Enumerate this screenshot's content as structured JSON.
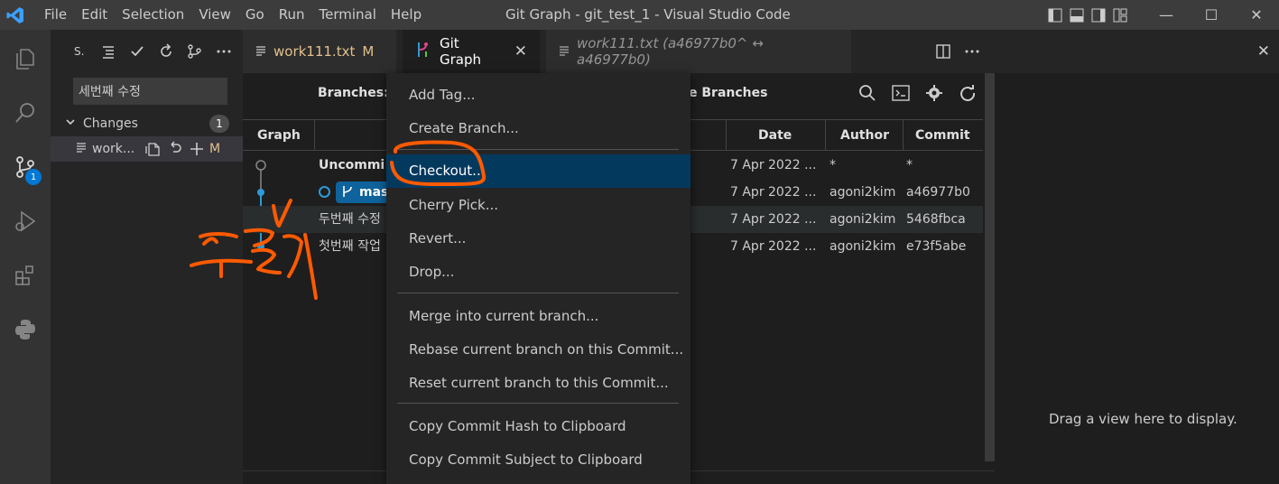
{
  "titlebar": {
    "menu": [
      "File",
      "Edit",
      "Selection",
      "View",
      "Go",
      "Run",
      "Terminal",
      "Help"
    ],
    "title": "Git Graph - git_test_1 - Visual Studio Code",
    "minimize": "—",
    "maximize": "☐",
    "close": "✕"
  },
  "activity": {
    "scm_badge": "1"
  },
  "sidebar": {
    "title": "S.",
    "commit_message": "세번째 수정",
    "changes_label": "Changes",
    "changes_count": "1",
    "file": {
      "name": "work...",
      "status": "M"
    }
  },
  "tabs": [
    {
      "label": "work111.txt",
      "badge": "M"
    },
    {
      "label": "Git Graph",
      "close": "✕"
    },
    {
      "label": "work111.txt (a46977b0^ ↔ a46977b0)"
    }
  ],
  "editor_close": "✕",
  "gitgraph": {
    "branches_label": "Branches:",
    "remote_label": "e Branches",
    "columns": {
      "graph": "Graph",
      "date": "Date",
      "author": "Author",
      "commit": "Commit"
    },
    "rows": [
      {
        "desc": "Uncommi",
        "date": "7 Apr 2022 ...",
        "author": "*",
        "commit": "*"
      },
      {
        "desc": "mas",
        "date": "7 Apr 2022 ...",
        "author": "agoni2kim",
        "commit": "a46977b0"
      },
      {
        "desc": "두번째 수정",
        "date": "7 Apr 2022 ...",
        "author": "agoni2kim",
        "commit": "5468fbca"
      },
      {
        "desc": "첫번째 작업",
        "date": "7 Apr 2022 ...",
        "author": "agoni2kim",
        "commit": "e73f5abe"
      }
    ]
  },
  "context_menu": {
    "items": [
      "Add Tag...",
      "Create Branch...",
      "Checkout...",
      "Cherry Pick...",
      "Revert...",
      "Drop...",
      "Merge into current branch...",
      "Rebase current branch on this Commit...",
      "Reset current branch to this Commit...",
      "Copy Commit Hash to Clipboard",
      "Copy Commit Subject to Clipboard"
    ]
  },
  "right_panel": {
    "message": "Drag a view here to display."
  },
  "colors": {
    "accent": "#0078d4",
    "menu_selection": "#04395e",
    "annotation": "#ff5a00",
    "modified": "#e2c08d"
  }
}
